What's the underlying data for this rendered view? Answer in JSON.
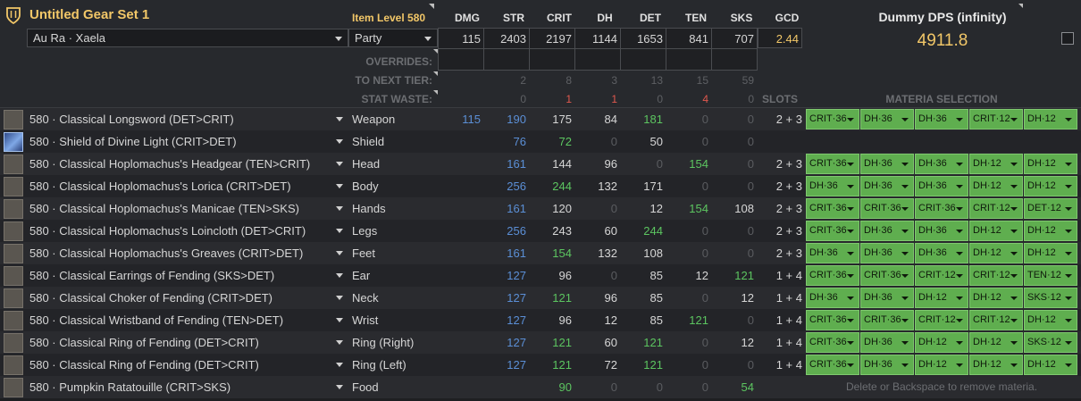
{
  "header": {
    "title": "Untitled Gear Set 1",
    "item_level": "Item Level 580",
    "columns": [
      "DMG",
      "STR",
      "CRIT",
      "DH",
      "DET",
      "TEN",
      "SKS",
      "GCD"
    ],
    "race_select": "Au Ra · Xaela",
    "party_select": "Party",
    "totals": [
      "115",
      "2403",
      "2197",
      "1144",
      "1653",
      "841",
      "707"
    ],
    "gcd": "2.44",
    "overrides_label": "OVERRIDES:",
    "next_tier_label": "TO NEXT TIER:",
    "next_tier": [
      "2",
      "8",
      "3",
      "13",
      "15",
      "59"
    ],
    "stat_waste_label": "STAT WASTE:",
    "stat_waste": [
      "0",
      "1",
      "1",
      "0",
      "4",
      "0"
    ],
    "slots_label": "SLOTS",
    "materia_label": "MATERIA SELECTION"
  },
  "dps": {
    "title": "Dummy DPS (infinity)",
    "value": "4911.8"
  },
  "items": [
    {
      "name": "580 · Classical Longsword (DET>CRIT)",
      "slot": "Weapon",
      "dmg": "115",
      "str": "190",
      "crit": "175",
      "dh": "84",
      "det": "181",
      "ten": "0",
      "sks": "0",
      "slots": "2 + 3",
      "materia": [
        "CRIT·36",
        "DH·36",
        "DH·36",
        "CRIT·12",
        "DH·12"
      ]
    },
    {
      "name": "580 · Shield of Divine Light (CRIT>DET)",
      "slot": "Shield",
      "dmg": "",
      "str": "76",
      "crit": "72",
      "dh": "0",
      "det": "50",
      "ten": "0",
      "sks": "0",
      "slots": "",
      "materia": []
    },
    {
      "name": "580 · Classical Hoplomachus's Headgear (TEN>CRIT)",
      "slot": "Head",
      "dmg": "",
      "str": "161",
      "crit": "144",
      "dh": "96",
      "det": "0",
      "ten": "154",
      "sks": "0",
      "slots": "2 + 3",
      "materia": [
        "CRIT·36",
        "DH·36",
        "DH·36",
        "DH·12",
        "DH·12"
      ]
    },
    {
      "name": "580 · Classical Hoplomachus's Lorica (CRIT>DET)",
      "slot": "Body",
      "dmg": "",
      "str": "256",
      "crit": "244",
      "dh": "132",
      "det": "171",
      "ten": "0",
      "sks": "0",
      "slots": "2 + 3",
      "materia": [
        "DH·36",
        "DH·36",
        "DH·36",
        "DH·12",
        "DH·12"
      ]
    },
    {
      "name": "580 · Classical Hoplomachus's Manicae (TEN>SKS)",
      "slot": "Hands",
      "dmg": "",
      "str": "161",
      "crit": "120",
      "dh": "0",
      "det": "12",
      "ten": "154",
      "sks": "108",
      "slots": "2 + 3",
      "materia": [
        "CRIT·36",
        "CRIT·36",
        "CRIT·36",
        "CRIT·12",
        "DET·12"
      ]
    },
    {
      "name": "580 · Classical Hoplomachus's Loincloth (DET>CRIT)",
      "slot": "Legs",
      "dmg": "",
      "str": "256",
      "crit": "243",
      "dh": "60",
      "det": "244",
      "ten": "0",
      "sks": "0",
      "slots": "2 + 3",
      "materia": [
        "CRIT·36",
        "DH·36",
        "DH·36",
        "DH·12",
        "DH·12"
      ]
    },
    {
      "name": "580 · Classical Hoplomachus's Greaves (CRIT>DET)",
      "slot": "Feet",
      "dmg": "",
      "str": "161",
      "crit": "154",
      "dh": "132",
      "det": "108",
      "ten": "0",
      "sks": "0",
      "slots": "2 + 3",
      "materia": [
        "DH·36",
        "DH·36",
        "DH·36",
        "DH·12",
        "DH·12"
      ]
    },
    {
      "name": "580 · Classical Earrings of Fending (SKS>DET)",
      "slot": "Ear",
      "dmg": "",
      "str": "127",
      "crit": "96",
      "dh": "0",
      "det": "85",
      "ten": "12",
      "sks": "121",
      "slots": "1 + 4",
      "materia": [
        "CRIT·36",
        "CRIT·36",
        "CRIT·12",
        "CRIT·12",
        "TEN·12"
      ]
    },
    {
      "name": "580 · Classical Choker of Fending (CRIT>DET)",
      "slot": "Neck",
      "dmg": "",
      "str": "127",
      "crit": "121",
      "dh": "96",
      "det": "85",
      "ten": "0",
      "sks": "12",
      "slots": "1 + 4",
      "materia": [
        "DH·36",
        "DH·36",
        "DH·12",
        "DH·12",
        "SKS·12"
      ]
    },
    {
      "name": "580 · Classical Wristband of Fending (TEN>DET)",
      "slot": "Wrist",
      "dmg": "",
      "str": "127",
      "crit": "96",
      "dh": "12",
      "det": "85",
      "ten": "121",
      "sks": "0",
      "slots": "1 + 4",
      "materia": [
        "CRIT·36",
        "CRIT·36",
        "CRIT·12",
        "CRIT·12",
        "DH·12"
      ]
    },
    {
      "name": "580 · Classical Ring of Fending (DET>CRIT)",
      "slot": "Ring (Right)",
      "dmg": "",
      "str": "127",
      "crit": "121",
      "dh": "60",
      "det": "121",
      "ten": "0",
      "sks": "12",
      "slots": "1 + 4",
      "materia": [
        "CRIT·36",
        "DH·36",
        "DH·12",
        "DH·12",
        "SKS·12"
      ]
    },
    {
      "name": "580 · Classical Ring of Fending (DET>CRIT)",
      "slot": "Ring (Left)",
      "dmg": "",
      "str": "127",
      "crit": "121",
      "dh": "72",
      "det": "121",
      "ten": "0",
      "sks": "0",
      "slots": "1 + 4",
      "materia": [
        "CRIT·36",
        "DH·36",
        "DH·12",
        "DH·12",
        "DH·12"
      ]
    },
    {
      "name": "580 · Pumpkin Ratatouille (CRIT>SKS)",
      "slot": "Food",
      "dmg": "",
      "str": "",
      "crit": "90",
      "dh": "0",
      "det": "0",
      "ten": "0",
      "sks": "54",
      "slots": "",
      "materia": []
    }
  ],
  "footer_hint": "Delete or Backspace to remove materia.",
  "colors": {
    "title_gold": "#f2c768",
    "stat_blue": "#5b8fd6",
    "stat_green": "#5cc560",
    "waste_red": "#e0584e",
    "materia_green": "#5fae4f"
  }
}
